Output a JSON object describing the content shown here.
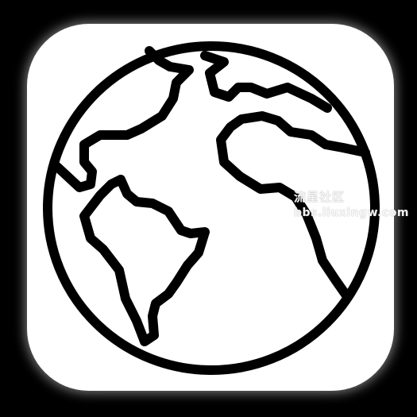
{
  "app_icon": {
    "icon": "globe-icon",
    "background_color": "#ffffff",
    "stroke_color": "#000000"
  },
  "watermark": {
    "line1": "流星社区",
    "line2": "bbs.liuxingw.com"
  }
}
